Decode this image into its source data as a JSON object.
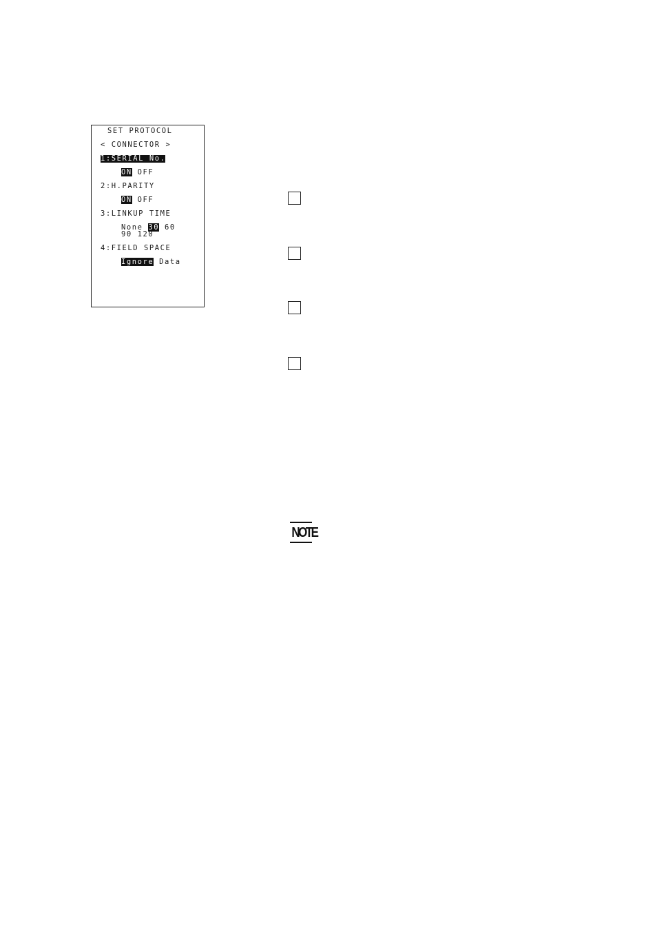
{
  "lcd_screen": {
    "title": "SET PROTOCOL",
    "subtitle": "< CONNECTOR >",
    "items": [
      {
        "label": "1:SERIAL No.",
        "label_selected": true,
        "options": [
          {
            "text": "ON",
            "selected": true
          },
          {
            "text": "OFF",
            "selected": false
          }
        ]
      },
      {
        "label": "2:H.PARITY",
        "label_selected": false,
        "options": [
          {
            "text": "ON",
            "selected": true
          },
          {
            "text": "OFF",
            "selected": false
          }
        ]
      },
      {
        "label": "3:LINKUP TIME",
        "label_selected": false,
        "options": [
          {
            "text": "None",
            "selected": false
          },
          {
            "text": "30",
            "selected": true
          },
          {
            "text": "60",
            "selected": false
          },
          {
            "text": "90",
            "selected": false
          },
          {
            "text": "120",
            "selected": false
          }
        ]
      },
      {
        "label": "4:FIELD SPACE",
        "label_selected": false,
        "options": [
          {
            "text": "Ignore",
            "selected": true
          },
          {
            "text": "Data",
            "selected": false
          }
        ]
      }
    ]
  },
  "checkboxes": [
    {
      "checked": false
    },
    {
      "checked": false
    },
    {
      "checked": false
    },
    {
      "checked": false
    }
  ],
  "note": {
    "icon": "note-icon",
    "label": "NOTE"
  }
}
